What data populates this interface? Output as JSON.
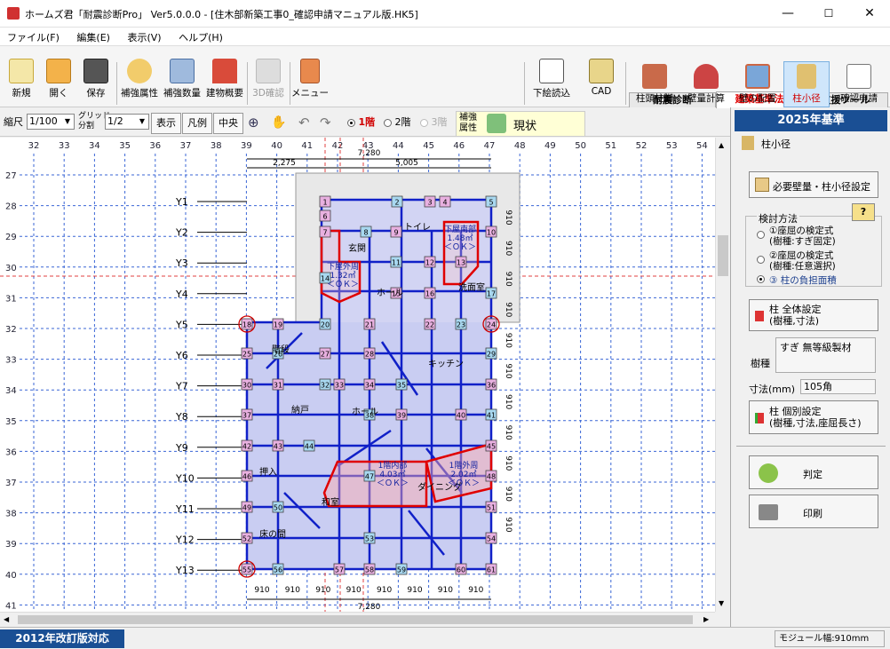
{
  "window": {
    "title": "ホームズ君「耐震診断Pro」 Ver5.0.0.0 - [住木部新築工事0_確認申請マニュアル版.HK5]",
    "minimize": "—",
    "maximize": "☐",
    "close": "✕"
  },
  "menu": [
    "ファイル(F)",
    "編集(E)",
    "表示(V)",
    "ヘルプ(H)"
  ],
  "toolbar": {
    "left": [
      {
        "label": "新規",
        "icon": "new-file-icon"
      },
      {
        "label": "開く",
        "icon": "open-folder-icon"
      },
      {
        "label": "保存",
        "icon": "save-disk-icon"
      },
      {
        "label": "補強属性",
        "icon": "reinforce-attr-icon"
      },
      {
        "label": "補強数量",
        "icon": "calculator-icon"
      },
      {
        "label": "建物概要",
        "icon": "house-icon"
      },
      {
        "label": "3D確認",
        "icon": "3d-view-icon"
      },
      {
        "label": "メニュー",
        "icon": "menu-exit-icon"
      }
    ],
    "mid": [
      {
        "label": "下絵読込",
        "icon": "underlay-icon"
      },
      {
        "label": "CAD",
        "icon": "cad-icon"
      }
    ],
    "tabs": [
      "耐震診断",
      "建築基準法",
      "支援ツール"
    ],
    "right": [
      {
        "label": "柱頭柱脚",
        "icon": "column-joint-icon"
      },
      {
        "label": "壁量計算",
        "icon": "wall-quantity-icon"
      },
      {
        "label": "壁の配置",
        "icon": "wall-layout-icon"
      },
      {
        "label": "柱小径",
        "icon": "column-diameter-icon"
      },
      {
        "label": "確認申請",
        "icon": "application-icon"
      }
    ]
  },
  "toolbar2": {
    "scale_label": "縮尺",
    "scale_value": "1/100",
    "grid_label": "グリッド\n分割",
    "grid_value": "1/2",
    "display": "表示",
    "legend": "凡例",
    "center": "中央",
    "floors": [
      "1階",
      "2階",
      "3階"
    ],
    "hoshu_label": "補強\n属性",
    "hoshu_value": "現状"
  },
  "grid": {
    "x_labels": [
      "32",
      "33",
      "34",
      "35",
      "36",
      "37",
      "38",
      "39",
      "40",
      "41",
      "42",
      "43",
      "44",
      "45",
      "46",
      "47",
      "48",
      "49",
      "50",
      "51",
      "52",
      "53",
      "54"
    ],
    "y_labels": [
      "27",
      "28",
      "29",
      "30",
      "31",
      "32",
      "33",
      "34",
      "35",
      "36",
      "37",
      "38",
      "39",
      "40",
      "41"
    ],
    "row_labels": [
      "Y1",
      "Y2",
      "Y3",
      "Y4",
      "Y5",
      "Y6",
      "Y7",
      "Y8",
      "Y9",
      "Y10",
      "Y11",
      "Y12",
      "Y13"
    ],
    "dim_top_total": "7,280",
    "dim_top_a": "2,275",
    "dim_top_b": "5,005",
    "dim_bottom_total": "7,280",
    "dim_bottom_unit": "910",
    "dim_right_unit": "910"
  },
  "columns": [
    "1",
    "2",
    "3",
    "4",
    "5",
    "6",
    "7",
    "8",
    "9",
    "10",
    "11",
    "12",
    "13",
    "14",
    "15",
    "16",
    "17",
    "18",
    "19",
    "20",
    "21",
    "22",
    "23",
    "24",
    "25",
    "26",
    "27",
    "28",
    "29",
    "30",
    "31",
    "32",
    "33",
    "34",
    "35",
    "36",
    "37",
    "38",
    "39",
    "40",
    "41",
    "42",
    "43",
    "44",
    "45",
    "46",
    "47",
    "48",
    "49",
    "50",
    "51",
    "52",
    "53",
    "54",
    "55",
    "56",
    "57",
    "58",
    "59",
    "60",
    "61"
  ],
  "rooms": [
    "玄関",
    "ホール",
    "洗面室",
    "トイレ",
    "階段",
    "キッチン",
    "納戸",
    "ホール",
    "押入",
    "和室",
    "ダイニング",
    "床の間"
  ],
  "zones": [
    {
      "label": "下屋南部",
      "area": "1.48㎡",
      "status": "＜ＯＫ＞"
    },
    {
      "label": "下屋外周",
      "area": "1.32㎡",
      "status": "＜ＯＫ＞"
    },
    {
      "label": "1階内部",
      "area": "4.03㎡",
      "status": "＜ＯＫ＞"
    },
    {
      "label": "1階外周",
      "area": "2.02㎡",
      "status": "＜ＯＫ＞"
    }
  ],
  "panel": {
    "title": "2025年基準",
    "section": "柱小径",
    "btn_required": "必要壁量・柱小径設定",
    "method_title": "検討方法",
    "help": "?",
    "methods": [
      "①座屈の検定式\n(樹種:すぎ固定)",
      "②座屈の検定式\n(樹種:任意選択)",
      "③ 柱の負担面積"
    ],
    "btn_all": "柱 全体設定\n(樹種,寸法)",
    "species_label": "樹種",
    "species_value": "すぎ 無等級製材",
    "size_label": "寸法(mm)",
    "size_value": "105角",
    "btn_individual": "柱 個別設定\n(樹種,寸法,座屈長さ)",
    "judge": "判定",
    "print": "印刷"
  },
  "status": {
    "left": "2012年改訂版対応",
    "right": "モジュール幅:910mm"
  }
}
